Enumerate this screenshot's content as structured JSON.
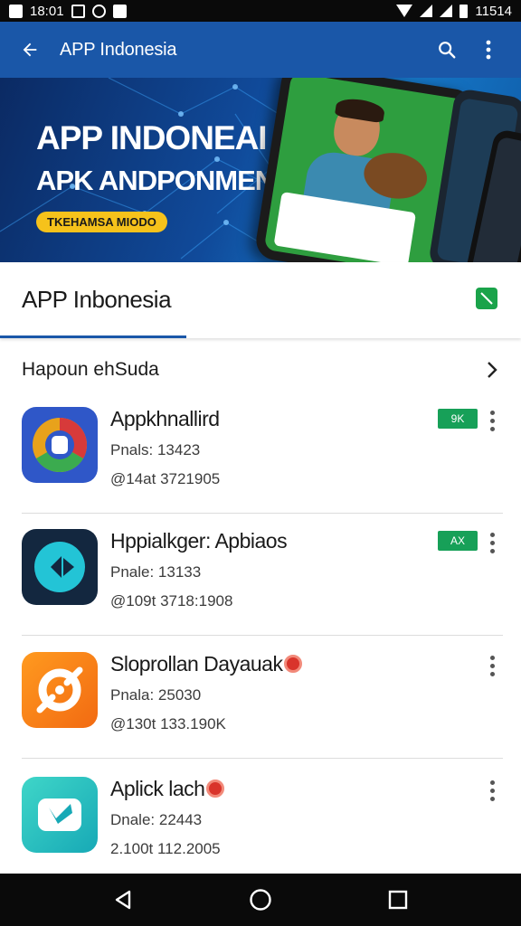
{
  "status_bar": {
    "time_left": "18:01",
    "time_right": "11514"
  },
  "app_bar": {
    "title": "APP Indonesia",
    "color": "#1a57a8"
  },
  "banner": {
    "line1": "APP INDONEAI",
    "line2": "APK ANDPONMENU",
    "pill": "TKEHAMSA MIODO"
  },
  "header": {
    "title": "APP Inbonesia",
    "accent": "#1aa34a"
  },
  "section": {
    "title": "Hapoun ehSuda"
  },
  "apps": [
    {
      "name": "Appkhnallird",
      "line1": "Pnals: 13423",
      "line2": "@14at 3721905",
      "tag": "9K",
      "icon": "chrome-like-icon",
      "has_badge": false
    },
    {
      "name": "Hppialkger: Apbiaos",
      "line1": "Pnale: 13133",
      "line2": "@109t 3718:1908",
      "tag": "AX",
      "icon": "play-arrow-icon",
      "has_badge": false
    },
    {
      "name": "Sloprollan Dayauak",
      "line1": "Pnala: 25030",
      "line2": "@130t 133.190K",
      "tag": "",
      "icon": "orange-disc-icon",
      "has_badge": true
    },
    {
      "name": "Aplick lach",
      "line1": "Dnale: 22443",
      "line2": "2.100t 112.2005",
      "tag": "",
      "icon": "teal-message-icon",
      "has_badge": true
    }
  ]
}
